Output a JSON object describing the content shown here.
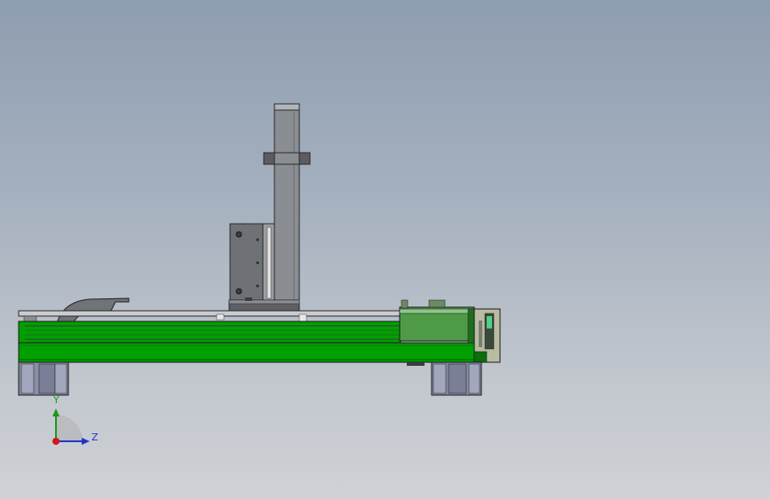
{
  "viewport": {
    "background_top": "#8e9db0",
    "background_bottom": "#cfd2d6"
  },
  "model": {
    "frame_color": "#00a000",
    "frame_dark_color": "#1e6e1e",
    "column_color": "#8a8d92",
    "carriage_color": "#6e7176",
    "foot_color": "#8a8ea6",
    "cable_chain_color": "#707378",
    "motor_box_color": "#4f9a47",
    "end_plate_color": "#b9bca3"
  },
  "triad": {
    "y_label": "Y",
    "z_label": "Z",
    "y_color": "#1a9a1a",
    "z_color": "#2233cc",
    "origin_color": "#d01818"
  }
}
